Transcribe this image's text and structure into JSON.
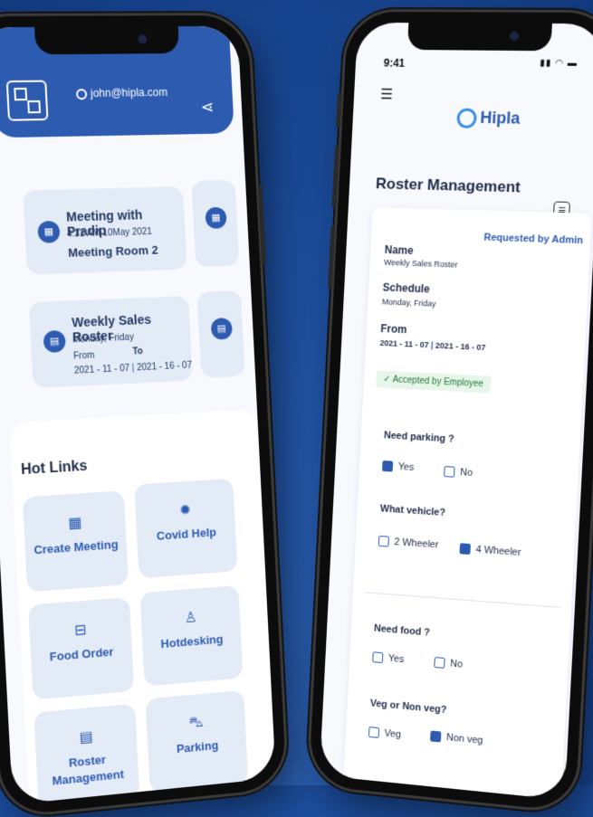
{
  "left_phone": {
    "email": "john@hipla.com",
    "cards": [
      {
        "title": "Meeting with Pradip",
        "time": "4:32 AM 10May 2021",
        "room": "Meeting Room 2"
      },
      {
        "title": "Weekly Sales Roster",
        "days": "Monday, Friday",
        "from_label": "From",
        "to_label": "To",
        "from": "2021 - 11 - 07",
        "to": "2021 - 16 - 07"
      }
    ],
    "hot_links_title": "Hot Links",
    "tiles": [
      {
        "label": "Create Meeting",
        "icon": "meeting-icon"
      },
      {
        "label": "Covid Help",
        "icon": "virus-icon"
      },
      {
        "label": "Food Order",
        "icon": "food-icon"
      },
      {
        "label": "Hotdesking",
        "icon": "chair-icon"
      },
      {
        "label": "Roster Management",
        "icon": "calendar-icon"
      },
      {
        "label": "Parking",
        "icon": "car-icon"
      }
    ]
  },
  "right_phone": {
    "status_time": "9:41",
    "logo_text": "Hipla",
    "title": "Roster Management",
    "requested_by": "Requested by Admin",
    "name_label": "Name",
    "name_value": "Weekly Sales Roster",
    "schedule_label": "Schedule",
    "schedule_value": "Monday, Friday",
    "from_label": "From",
    "from_value": "2021 - 11 - 07",
    "to_value": "2021 - 16 - 07",
    "status": "Accepted by Employee",
    "q_parking": "Need parking ?",
    "opt_yes": "Yes",
    "opt_no": "No",
    "q_vehicle": "What vehicle?",
    "opt_2w": "2 Wheeler",
    "opt_4w": "4 Wheeler",
    "q_food": "Need food ?",
    "q_veg": "Veg or Non veg?",
    "opt_veg": "Veg",
    "opt_nonveg": "Non veg",
    "selected": {
      "parking": "Yes",
      "vehicle": "4 Wheeler",
      "food": null,
      "veg": "Non veg"
    }
  }
}
